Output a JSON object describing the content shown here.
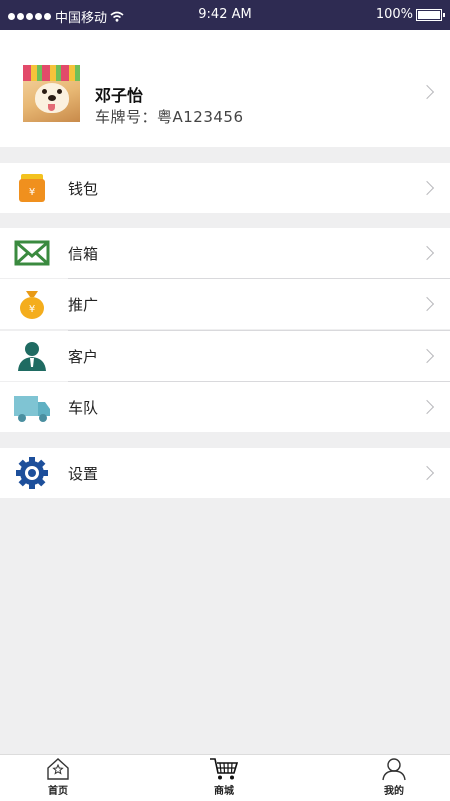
{
  "status_bar": {
    "carrier": "中国移动",
    "time": "9:42 AM",
    "battery": "100%"
  },
  "profile": {
    "name": "邓子怡",
    "plate": "车牌号：粤A123456"
  },
  "menu": {
    "wallet": "钱包",
    "inbox": "信箱",
    "promotion": "推广",
    "customers": "客户",
    "fleet": "车队",
    "settings": "设置"
  },
  "icons": {
    "wallet": "wallet-icon",
    "inbox": "envelope-icon",
    "promotion": "money-bag-icon",
    "customers": "person-icon",
    "fleet": "truck-icon",
    "settings": "gear-icon"
  },
  "tabbar": {
    "home": "首页",
    "mall": "商城",
    "mine": "我的"
  },
  "colors": {
    "status_bar": "#2e2b52",
    "background": "#efeff0",
    "settings_blue": "#1d4f9b",
    "inbox_green": "#3a8a3f"
  }
}
